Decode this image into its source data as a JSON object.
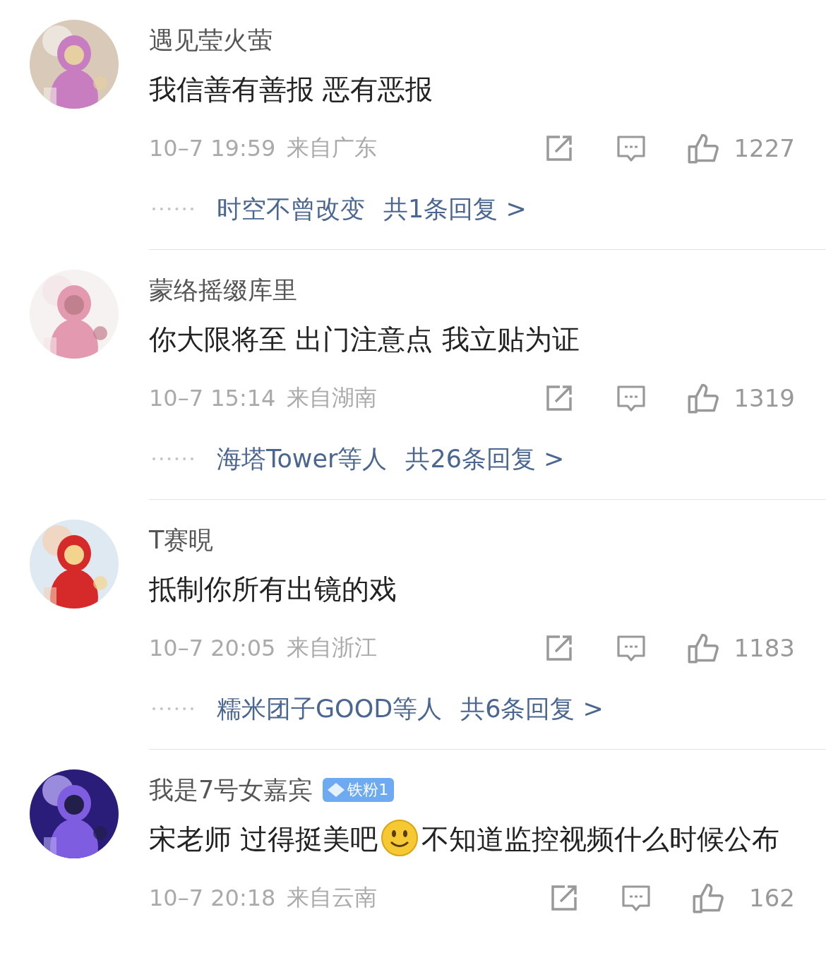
{
  "comments": [
    {
      "name": "遇见莹火萤",
      "content": [
        {
          "kind": "text",
          "text": "我信善有善报 恶有恶报"
        }
      ],
      "time": "10–7 19:59",
      "location": "来自广东",
      "likes": "1227",
      "reply": {
        "names": "时空不曾改变",
        "total": "共1条回复 >"
      }
    },
    {
      "name": "蒙络摇缀库里",
      "content": [
        {
          "kind": "text",
          "text": "你大限将至  出门注意点  我立贴为证"
        }
      ],
      "time": "10–7 15:14",
      "location": "来自湖南",
      "likes": "1319",
      "reply": {
        "names": "海塔Tower等人",
        "total": "共26条回复 >"
      }
    },
    {
      "name": "T赛晛",
      "content": [
        {
          "kind": "text",
          "text": "抵制你所有出镜的戏"
        }
      ],
      "time": "10–7 20:05",
      "location": "来自浙江",
      "likes": "1183",
      "reply": {
        "names": "糯米团子GOOD等人",
        "total": "共6条回复 >"
      }
    },
    {
      "name": "我是7号女嘉宾",
      "badge": "铁粉1",
      "content": [
        {
          "kind": "text",
          "text": "宋老师 过得挺美吧"
        },
        {
          "kind": "emoji"
        },
        {
          "kind": "text",
          "text": "不知道监控视频什么时候公布"
        }
      ],
      "time": "10–7 20:18",
      "location": "来自云南",
      "likes": "162"
    }
  ]
}
